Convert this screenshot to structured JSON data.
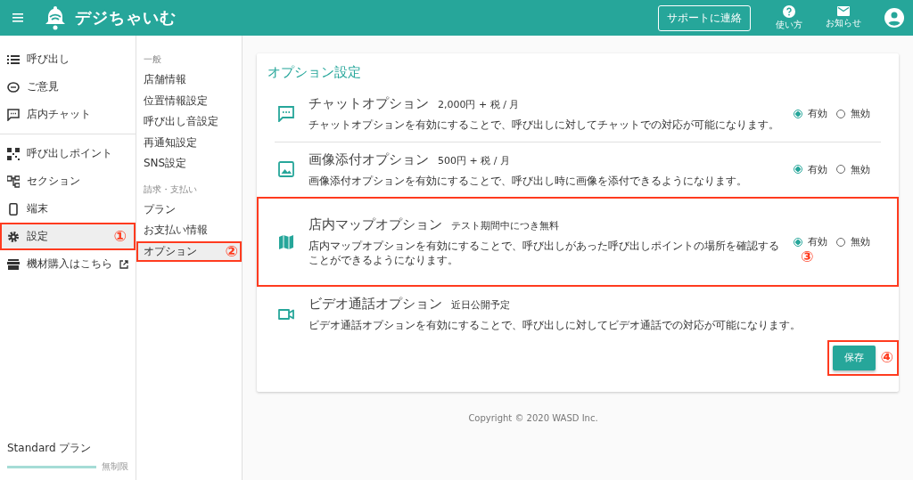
{
  "header": {
    "logo": "デジちゃいむ",
    "support_button": "サポートに連絡",
    "help": "使い方",
    "notices": "お知らせ"
  },
  "nav": {
    "groups": [
      [
        {
          "label": "呼び出し",
          "selected": false
        },
        {
          "label": "ご意見",
          "selected": false
        },
        {
          "label": "店内チャット",
          "selected": false
        }
      ],
      [
        {
          "label": "呼び出しポイント",
          "selected": false
        },
        {
          "label": "セクション",
          "selected": false
        },
        {
          "label": "端末",
          "selected": false
        },
        {
          "label": "設定",
          "selected": true,
          "callout": "①"
        },
        {
          "label": "機材購入はこちら",
          "selected": false,
          "external": true
        }
      ]
    ],
    "plan": {
      "name": "Standard プラン",
      "level": 1,
      "limit": "無制限"
    }
  },
  "subnav": [
    {
      "heading": "一般",
      "items": [
        {
          "label": "店舗情報",
          "selected": false
        },
        {
          "label": "位置情報設定",
          "selected": false
        },
        {
          "label": "呼び出し音設定",
          "selected": false
        },
        {
          "label": "再通知設定",
          "selected": false
        },
        {
          "label": "SNS設定",
          "selected": false
        }
      ]
    },
    {
      "heading": "請求・支払い",
      "items": [
        {
          "label": "プラン",
          "selected": false
        },
        {
          "label": "お支払い情報",
          "selected": false
        },
        {
          "label": "オプション",
          "selected": true,
          "callout": "②"
        }
      ]
    }
  ],
  "card": {
    "title": "オプション設定",
    "options": [
      {
        "kind": "radio",
        "name": "チャットオプション",
        "price": "2,000円 + 税 / 月",
        "description": "チャットオプションを有効にすることで、呼び出しに対してチャットでの対応が可能になります。",
        "choices": [
          {
            "label": "有効",
            "selected": true
          },
          {
            "label": "無効",
            "selected": false
          }
        ],
        "divider": true
      },
      {
        "kind": "radio",
        "name": "画像添付オプション",
        "price": "500円 + 税 / 月",
        "description": "画像添付オプションを有効にすることで、呼び出し時に画像を添付できるようになります。",
        "choices": [
          {
            "label": "有効",
            "selected": true
          },
          {
            "label": "無効",
            "selected": false
          }
        ]
      },
      {
        "kind": "radio",
        "name": "店内マップオプション",
        "price": "テスト期間中につき無料",
        "description": "店内マップオプションを有効にすることで、呼び出しがあった呼び出しポイントの場所を確認することができるようになります。",
        "choices": [
          {
            "label": "有効",
            "selected": true
          },
          {
            "label": "無効",
            "selected": false
          }
        ],
        "callout": "③"
      },
      {
        "kind": "info",
        "name": "ビデオ通話オプション",
        "price": "近日公開予定",
        "description": "ビデオ通話オプションを有効にすることで、呼び出しに対してビデオ通話での対応が可能になります。"
      }
    ],
    "save_button": "保存",
    "save_callout": "④"
  },
  "footer": "Copyright © 2020 WASD Inc."
}
